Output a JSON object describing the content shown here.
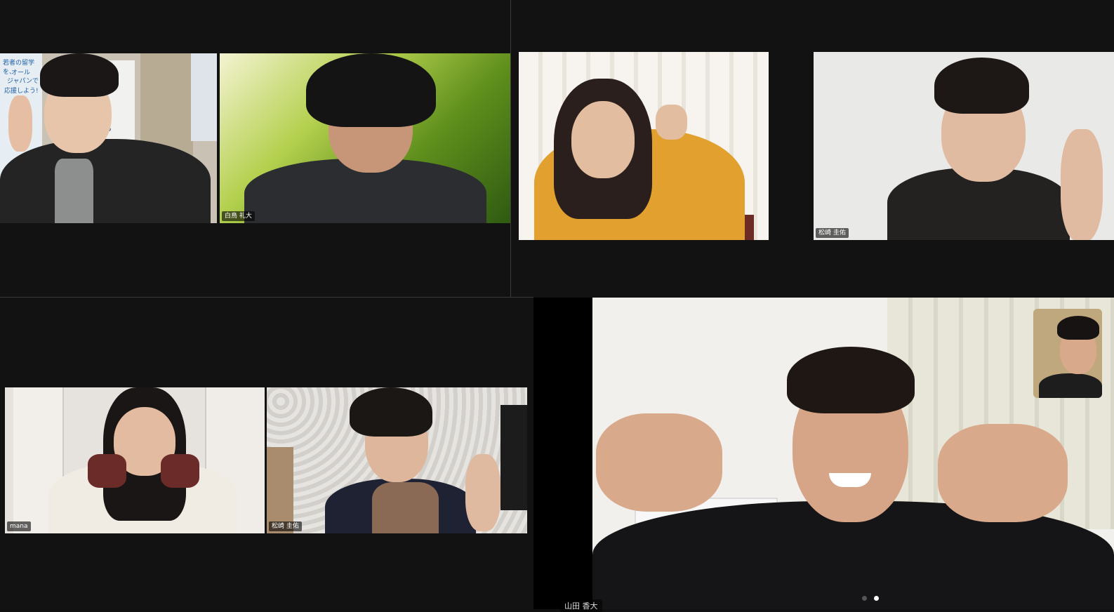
{
  "panels": {
    "top_left": {
      "tiles": [
        {
          "name": ""
        },
        {
          "name": "白鳥 礼大"
        }
      ],
      "poster_lines": [
        "若者の留学を、",
        "オール",
        "ジャパンで",
        "応援しよう!",
        "0。"
      ]
    },
    "top_right": {
      "tiles": [
        {
          "name": ""
        },
        {
          "name": "松崎 圭佑"
        }
      ]
    },
    "bottom_left": {
      "tiles": [
        {
          "name": "mana"
        },
        {
          "name": "松崎 圭佑"
        }
      ]
    },
    "bottom_right": {
      "speaker_name": "山田 香大",
      "page_indicator": {
        "total": 2,
        "active": 2
      }
    }
  },
  "colors": {
    "background": "#111111",
    "divider": "#3a3a3a",
    "accent_yellow": "#e2a02e",
    "dot_inactive": "#555555",
    "dot_active": "#ffffff"
  }
}
